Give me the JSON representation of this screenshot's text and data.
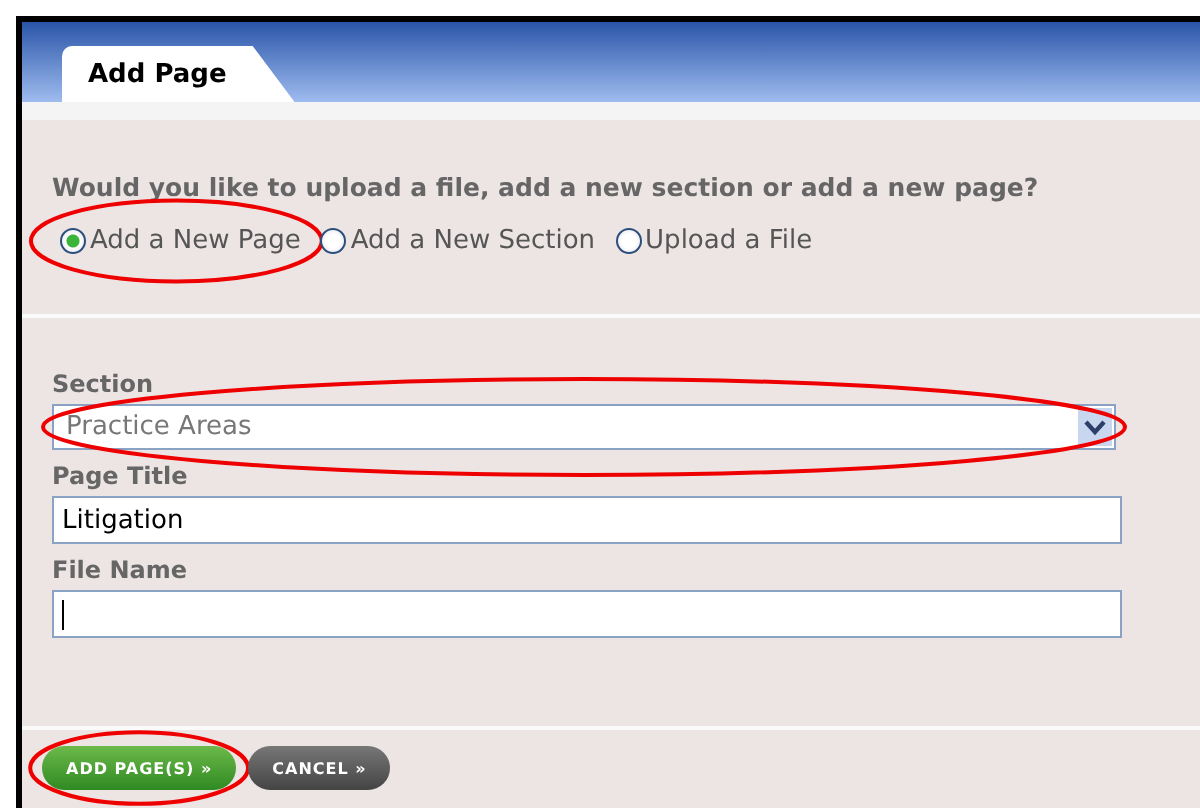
{
  "tabs": [
    {
      "label": "Add Page",
      "selected": true
    }
  ],
  "question": "Would you like to upload a file, add a new section or add a new page?",
  "options": [
    {
      "label": "Add a New Page",
      "selected": true,
      "circled": true
    },
    {
      "label": "Add a New Section",
      "selected": false,
      "circled": false
    },
    {
      "label": "Upload a File",
      "selected": false,
      "circled": false
    }
  ],
  "fields": [
    {
      "kind": "select",
      "label": "Section",
      "value": "Practice Areas",
      "circled": true
    },
    {
      "kind": "text",
      "label": "Page Title",
      "value": "Litigation",
      "circled": false
    },
    {
      "kind": "text",
      "label": "File Name",
      "focused": true,
      "circled": false
    }
  ],
  "buttons": [
    {
      "kind": "primary",
      "label": "ADD PAGE(S) »",
      "circled": true
    },
    {
      "kind": "secondary",
      "label": "CANCEL »",
      "circled": false
    }
  ]
}
